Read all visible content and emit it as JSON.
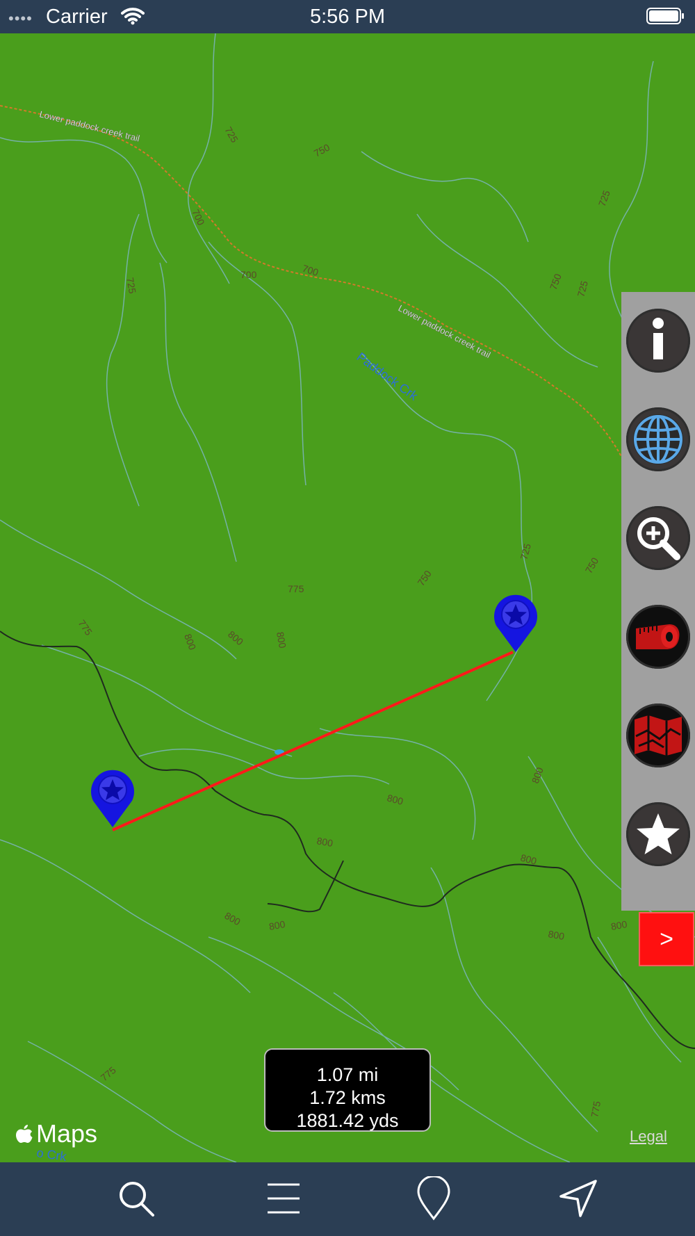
{
  "status_bar": {
    "carrier": "Carrier",
    "time": "5:56 PM"
  },
  "map": {
    "trail_labels": [
      "Lower paddock creek trail",
      "Lower paddock creek trail"
    ],
    "creek_labels": [
      "Paddock Crk",
      "o Crk"
    ],
    "contour_labels": [
      "725",
      "750",
      "700",
      "725",
      "700",
      "700",
      "725",
      "750",
      "725",
      "775",
      "750",
      "725",
      "750",
      "775",
      "800",
      "800",
      "800",
      "800",
      "800",
      "800",
      "800",
      "800",
      "800",
      "800",
      "800",
      "775",
      "775"
    ]
  },
  "side_panel": {
    "icons": [
      "info-icon",
      "globe-icon",
      "zoom-in-icon",
      "measure-tape-icon",
      "map-layers-icon",
      "star-icon"
    ]
  },
  "expand_button": {
    "label": ">"
  },
  "distance": {
    "miles": "1.07 mi",
    "kilometers": "1.72 kms",
    "yards": "1881.42 yds"
  },
  "attribution": {
    "maps_logo": "Maps",
    "legal": "Legal"
  },
  "tab_bar": {
    "icons": [
      "search-icon",
      "menu-icon",
      "pin-icon",
      "navigation-arrow-icon"
    ]
  },
  "colors": {
    "map_green": "#4a9e1c",
    "route_line": "#ff1a1a",
    "pin_blue": "#1515e0",
    "bar_background": "#2b3e54"
  }
}
